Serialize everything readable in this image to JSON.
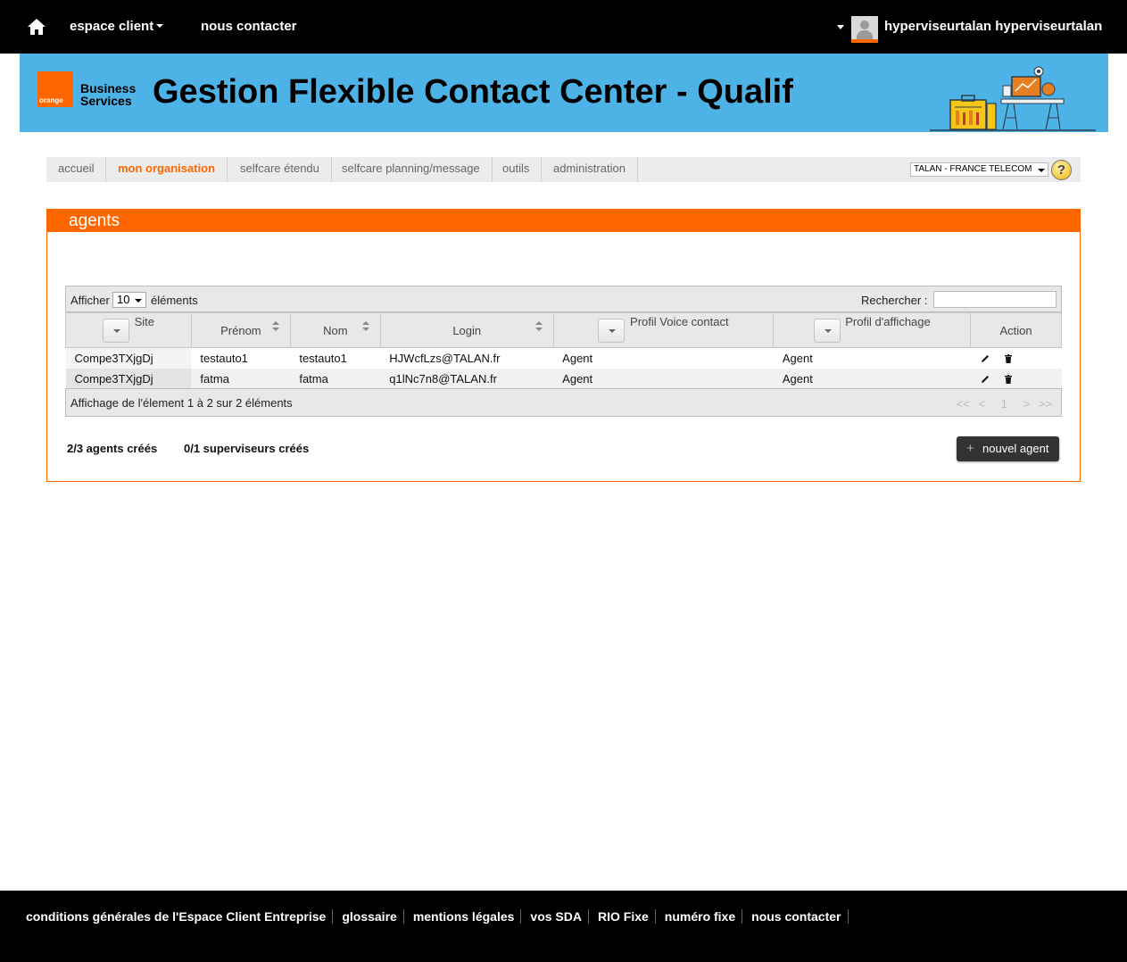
{
  "topbar": {
    "espace_client": "espace client",
    "nous_contacter": "nous contacter",
    "user_name": "hyperviseurtalan hyperviseurtalan"
  },
  "banner": {
    "logo_small": "orange",
    "logo_line1": "Business",
    "logo_line2": "Services",
    "title": "Gestion Flexible Contact Center - Qualif"
  },
  "nav": {
    "tabs": [
      {
        "label": "accueil",
        "active": false
      },
      {
        "label": "mon organisation",
        "active": true
      },
      {
        "label": "selfcare étendu",
        "active": false
      },
      {
        "label": "selfcare planning/message",
        "active": false
      },
      {
        "label": "outils",
        "active": false
      },
      {
        "label": "administration",
        "active": false
      }
    ],
    "organization": "TALAN - FRANCE TELECOM",
    "help_icon": "help-icon"
  },
  "panel": {
    "title": "agents"
  },
  "table": {
    "show_label": "Afficher",
    "length_value": "10",
    "elements_label": "éléments",
    "search_label": "Rechercher :",
    "search_value": "",
    "columns": [
      "Site",
      "Prénom",
      "Nom",
      "Login",
      "Profil Voice contact",
      "Profil d'affichage",
      "Action"
    ],
    "rows": [
      {
        "site": "Compe3TXjgDj",
        "prenom": "testauto1",
        "nom": "testauto1",
        "login": "HJWcfLzs@TALAN.fr",
        "profil_voice": "Agent",
        "profil_affichage": "Agent"
      },
      {
        "site": "Compe3TXjgDj",
        "prenom": "fatma",
        "nom": "fatma",
        "login": "q1lNc7n8@TALAN.fr",
        "profil_voice": "Agent",
        "profil_affichage": "Agent"
      }
    ],
    "info": "Affichage de l'élement 1 à 2 sur 2 éléments",
    "pager": {
      "first": "<<",
      "prev": "<",
      "page": "1",
      "next": ">",
      "last": ">>"
    }
  },
  "summary": {
    "agents": "2/3 agents créés",
    "supervisors": "0/1 superviseurs créés",
    "new_agent_button": "nouvel agent"
  },
  "footer": {
    "links": [
      "conditions générales de l'Espace Client Entreprise",
      "glossaire",
      "mentions légales",
      "vos SDA",
      "RIO Fixe",
      "numéro fixe",
      "nous contacter"
    ]
  },
  "colors": {
    "accent": "#ff6600",
    "banner": "#4db3e6",
    "bar": "#000000"
  }
}
